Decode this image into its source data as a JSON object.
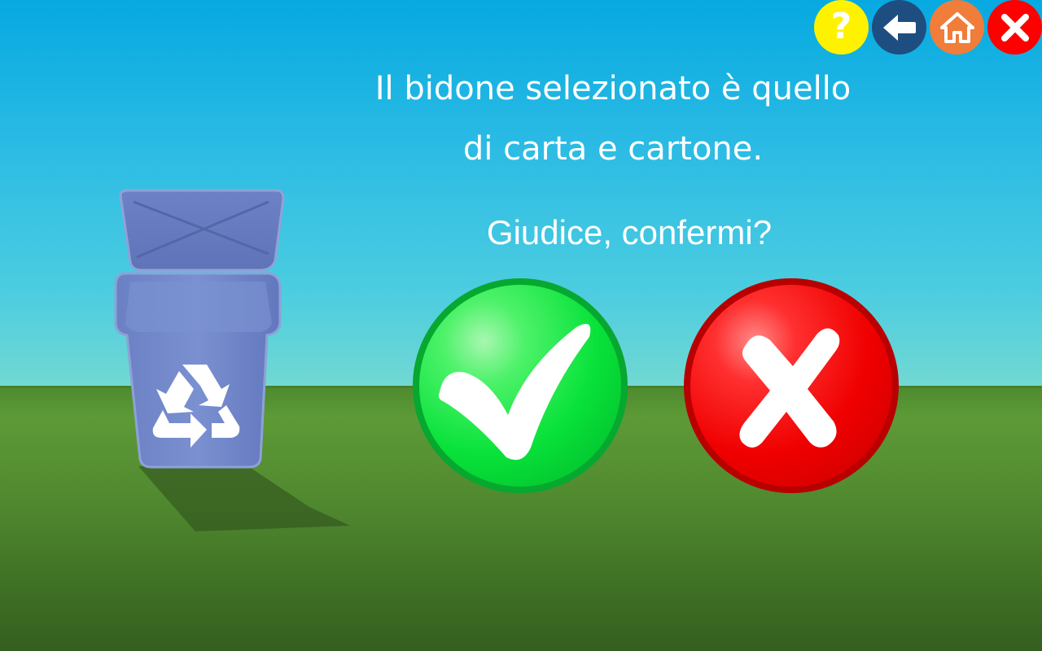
{
  "toolbar": {
    "help": {
      "glyph": "?",
      "color": "#fff200"
    },
    "back": {
      "color": "#1e4e80"
    },
    "home": {
      "color": "#f07d3a"
    },
    "close": {
      "color": "#ff0000"
    }
  },
  "message": {
    "line1": "Il bidone selezionato è quello",
    "line2": "di carta e cartone."
  },
  "question": "Giudice, confermi?",
  "bin": {
    "color": "#6f85c8",
    "icon": "recycle-icon"
  },
  "actions": {
    "confirm": {
      "icon": "checkmark-icon",
      "color": "#00d83a"
    },
    "reject": {
      "icon": "x-icon",
      "color": "#e80000"
    }
  }
}
